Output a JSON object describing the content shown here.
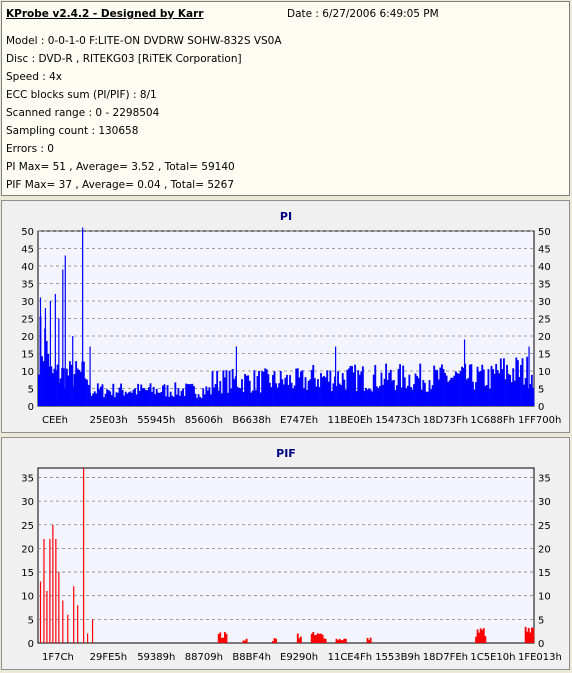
{
  "report": {
    "title": "KProbe v2.4.2 - Designed by Karr",
    "date": "Date : 6/27/2006 6:49:05 PM",
    "lines": [
      "Model : 0-0-1-0 F:LITE-ON DVDRW SOHW-832S  VS0A",
      "Disc : DVD-R , RITEKG03 [RiTEK Corporation]",
      "Speed : 4x",
      "ECC blocks sum (PI/PIF) : 8/1",
      "Scanned range : 0 - 2298504",
      "Sampling count : 130658",
      "Errors : 0",
      "PI Max= 51 , Average= 3.52 , Total= 59140",
      "PIF Max= 37 , Average= 0.04 , Total= 5267"
    ]
  },
  "colors": {
    "pi": "#0000ff",
    "pif": "#ff0000",
    "title": "#000080",
    "plot_bg": "#f4f4ff",
    "grid": "#808080"
  },
  "chart_data": [
    {
      "type": "bar",
      "title": "PI",
      "ylim": [
        0,
        50
      ],
      "yticks": [
        0,
        5,
        10,
        15,
        20,
        25,
        30,
        35,
        40,
        45,
        50
      ],
      "xticks": [
        "CEEh",
        "25E03h",
        "55945h",
        "85606h",
        "B6638h",
        "E747Eh",
        "11BE0Eh",
        "15473Ch",
        "18D73Fh",
        "1C688Fh",
        "1FF700h"
      ],
      "grid": true,
      "series": [
        {
          "segments": [
            {
              "from": 0.0,
              "to": 0.02,
              "base": 20
            },
            {
              "from": 0.02,
              "to": 0.1,
              "base": 10
            },
            {
              "from": 0.1,
              "to": 0.35,
              "base": 5
            },
            {
              "from": 0.35,
              "to": 0.55,
              "base": 8
            },
            {
              "from": 0.55,
              "to": 0.8,
              "base": 9
            },
            {
              "from": 0.8,
              "to": 0.92,
              "base": 9
            },
            {
              "from": 0.92,
              "to": 1.0,
              "base": 11
            }
          ],
          "spikes": [
            [
              0.005,
              31
            ],
            [
              0.015,
              28
            ],
            [
              0.025,
              30
            ],
            [
              0.035,
              32
            ],
            [
              0.042,
              25
            ],
            [
              0.05,
              39
            ],
            [
              0.055,
              43
            ],
            [
              0.07,
              20
            ],
            [
              0.09,
              51
            ],
            [
              0.105,
              17
            ],
            [
              0.4,
              17
            ],
            [
              0.6,
              17
            ],
            [
              0.86,
              19
            ],
            [
              0.99,
              17
            ]
          ]
        }
      ]
    },
    {
      "type": "bar",
      "title": "PIF",
      "ylim": [
        0,
        37
      ],
      "yticks": [
        0,
        5,
        10,
        15,
        20,
        25,
        30,
        35
      ],
      "xticks": [
        "1F7Ch",
        "29FE5h",
        "59389h",
        "88709h",
        "B8BF4h",
        "E9290h",
        "11CE4Fh",
        "1553B9h",
        "18D7FEh",
        "1C5E10h",
        "1FE013h"
      ],
      "grid": true,
      "series": [
        {
          "spikes": [
            [
              0.005,
              13
            ],
            [
              0.012,
              22
            ],
            [
              0.018,
              11
            ],
            [
              0.024,
              22
            ],
            [
              0.03,
              25
            ],
            [
              0.036,
              22
            ],
            [
              0.042,
              15
            ],
            [
              0.05,
              9
            ],
            [
              0.06,
              6
            ],
            [
              0.072,
              12
            ],
            [
              0.08,
              8
            ],
            [
              0.092,
              37
            ],
            [
              0.1,
              2
            ],
            [
              0.11,
              5
            ]
          ],
          "clusters": [
            [
              0.36,
              0.38,
              2
            ],
            [
              0.41,
              0.42,
              1
            ],
            [
              0.47,
              0.48,
              1
            ],
            [
              0.52,
              0.53,
              2
            ],
            [
              0.55,
              0.58,
              2
            ],
            [
              0.6,
              0.62,
              1
            ],
            [
              0.66,
              0.67,
              1
            ],
            [
              0.88,
              0.9,
              3
            ],
            [
              0.98,
              1.0,
              3
            ]
          ]
        }
      ]
    }
  ]
}
